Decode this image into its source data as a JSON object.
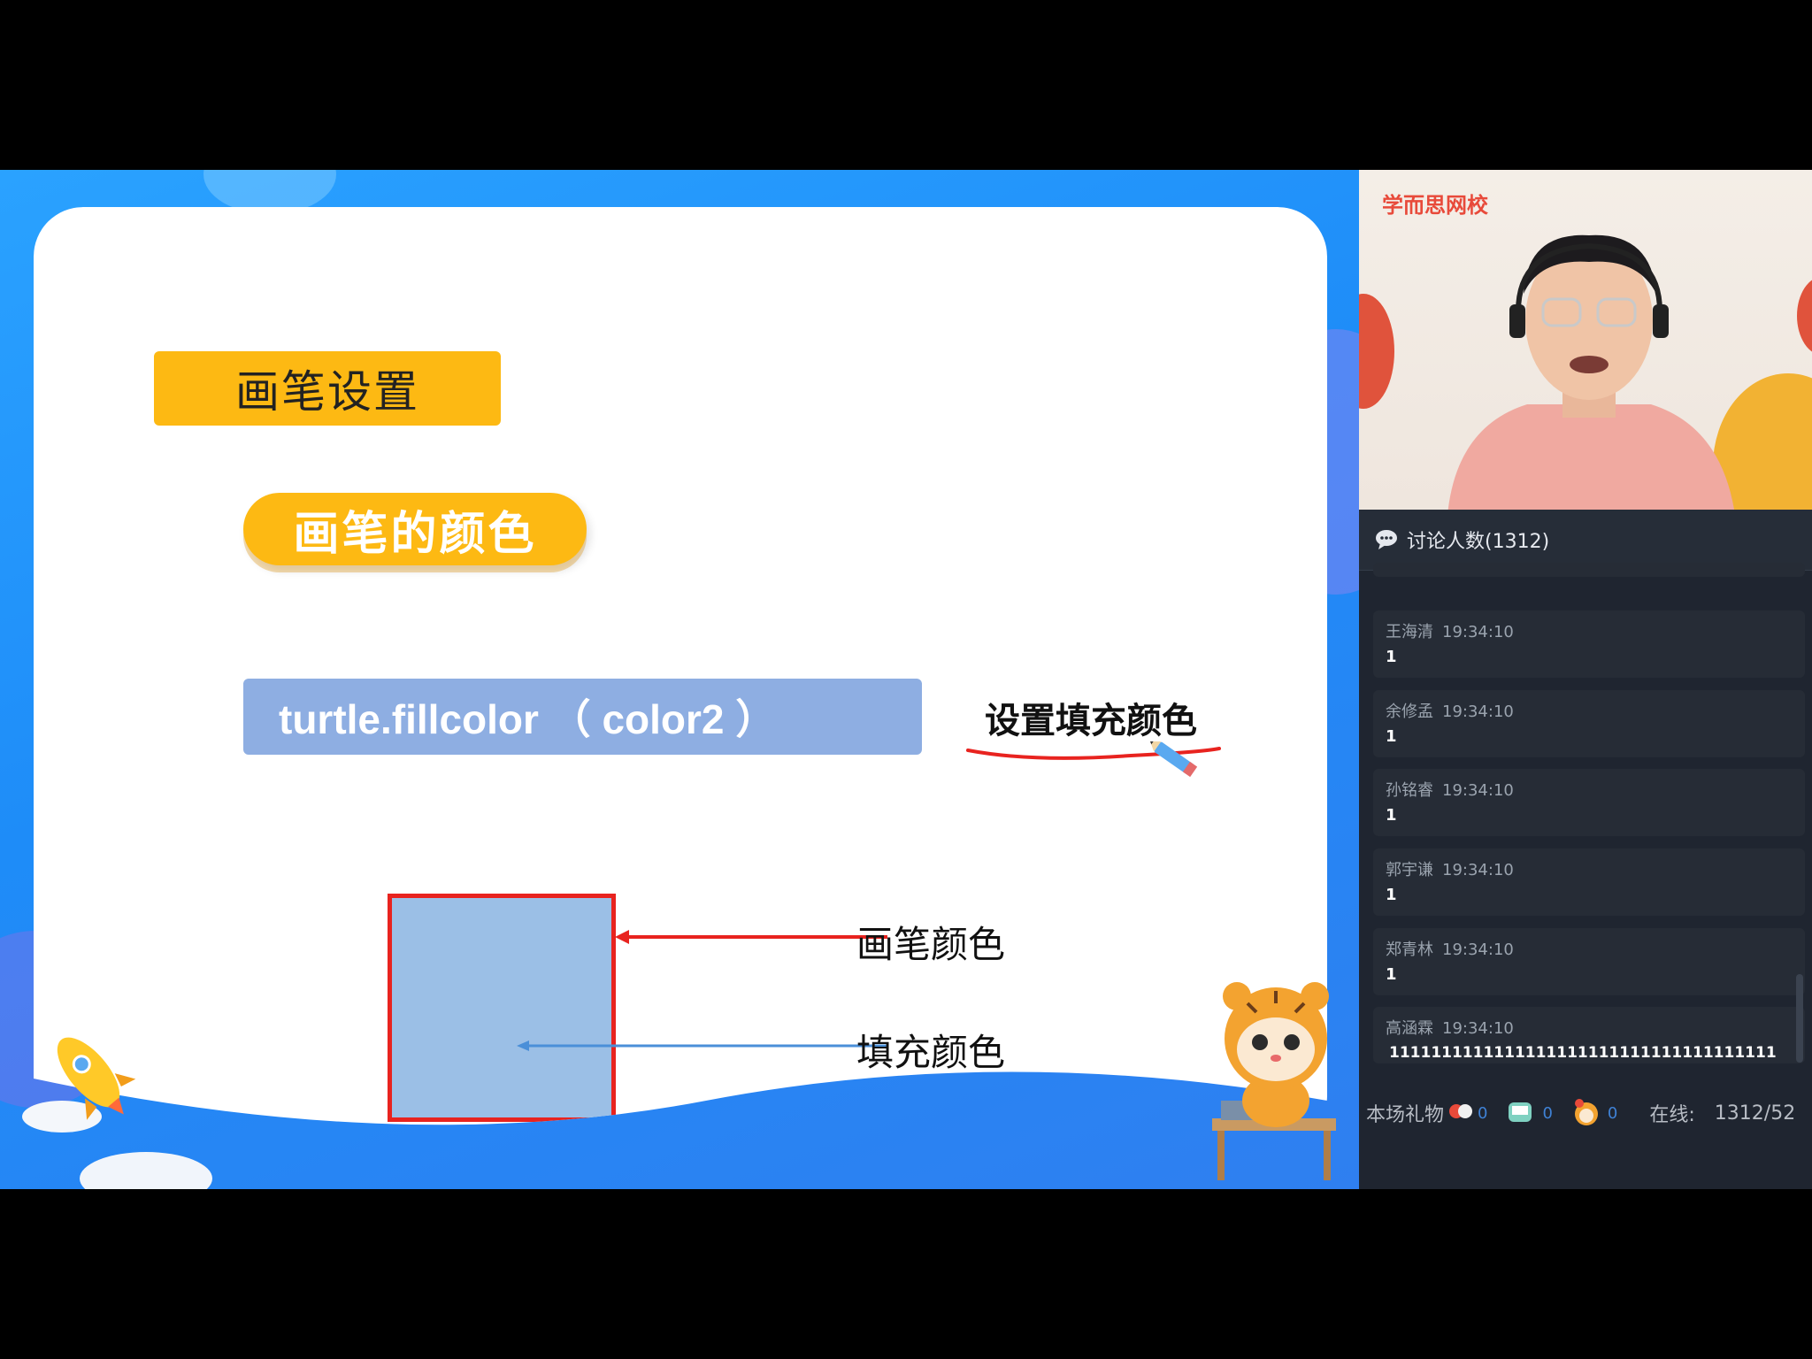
{
  "slide": {
    "section_title": "画笔设置",
    "subtopic": "画笔的颜色",
    "code": "turtle.fillcolor （ color2 ）",
    "code_note": "设置填充颜色",
    "label_pen": "画笔颜色",
    "label_fill": "填充颜色",
    "colors": {
      "accent": "#fdb913",
      "code_bg": "#8eaee2",
      "border_red": "#e8231f",
      "fill_blue": "#9bbfe6",
      "arrow_blue": "#4a8fd8"
    }
  },
  "video": {
    "brand": "学而思网校"
  },
  "chat": {
    "header": "讨论人数(1312)",
    "messages": [
      {
        "name": "王海清",
        "time": "19:34:10",
        "text": "1"
      },
      {
        "name": "余修孟",
        "time": "19:34:10",
        "text": "1"
      },
      {
        "name": "孙铭睿",
        "time": "19:34:10",
        "text": "1"
      },
      {
        "name": "郭宇谦",
        "time": "19:34:10",
        "text": "1"
      },
      {
        "name": "郑青林",
        "time": "19:34:10",
        "text": "1"
      },
      {
        "name": "高涵霖",
        "time": "19:34:10",
        "text": "1111111111111111111111111111111111111"
      }
    ],
    "footer": {
      "gifts_label": "本场礼物",
      "gift_counts": [
        "0",
        "0",
        "0"
      ],
      "online_label": "在线:",
      "online_value": "1312/52"
    }
  }
}
